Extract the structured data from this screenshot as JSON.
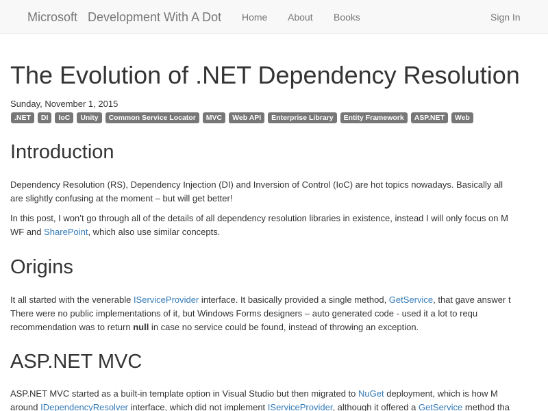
{
  "navbar": {
    "brand_primary": "Microsoft",
    "brand_secondary": "Development With A Dot",
    "links": [
      "Home",
      "About",
      "Books"
    ],
    "sign_in": "Sign In"
  },
  "post": {
    "title": "The Evolution of .NET Dependency Resolution",
    "date": "Sunday, November 1, 2015",
    "tags": [
      ".NET",
      "DI",
      "IoC",
      "Unity",
      "Common Service Locator",
      "MVC",
      "Web API",
      "Enterprise Library",
      "Entity Framework",
      "ASP.NET",
      "Web"
    ]
  },
  "sections": {
    "intro": {
      "heading": "Introduction",
      "p1_line1": "Dependency Resolution (RS), Dependency Injection (DI) and Inversion of Control (IoC) are hot topics nowadays. Basically all",
      "p1_line2": "are slightly confusing at the moment – but will get better!",
      "p2_line1": "In this post, I won’t go through all of the details of all dependency resolution libraries in existence, instead I will only focus on M",
      "p2_line2_a": "WF and ",
      "p2_line2_link": "SharePoint",
      "p2_line2_b": ", which also use similar concepts."
    },
    "origins": {
      "heading": "Origins",
      "l1_a": "It all started with the venerable ",
      "l1_link1": "IServiceProvider",
      "l1_b": " interface. It basically provided a single method, ",
      "l1_link2": "GetService",
      "l1_c": ", that gave answer t",
      "l2": "There were no public implementations of it, but Windows Forms designers – auto generated code - used it a lot to requ",
      "l3_a": "recommendation was to return ",
      "l3_bold": "null",
      "l3_b": " in case no service could be found, instead of throwing an exception."
    },
    "mvc": {
      "heading": "ASP.NET MVC",
      "l1_a": "ASP.NET MVC started as a built-in template option in Visual Studio but then migrated to ",
      "l1_link": "NuGet",
      "l1_b": " deployment, which is how M",
      "l2_a": "around ",
      "l2_link1": "IDependencyResolver",
      "l2_b": " interface, which did not implement ",
      "l2_link2": "IServiceProvider",
      "l2_c": ", although it offered a ",
      "l2_link3": "GetService",
      "l2_d": " method tha"
    }
  },
  "colors": {
    "navbar_bg": "#f8f8f8",
    "nav_text": "#777777",
    "tag_bg": "#777777",
    "link": "#337ab7",
    "text": "#333333"
  }
}
